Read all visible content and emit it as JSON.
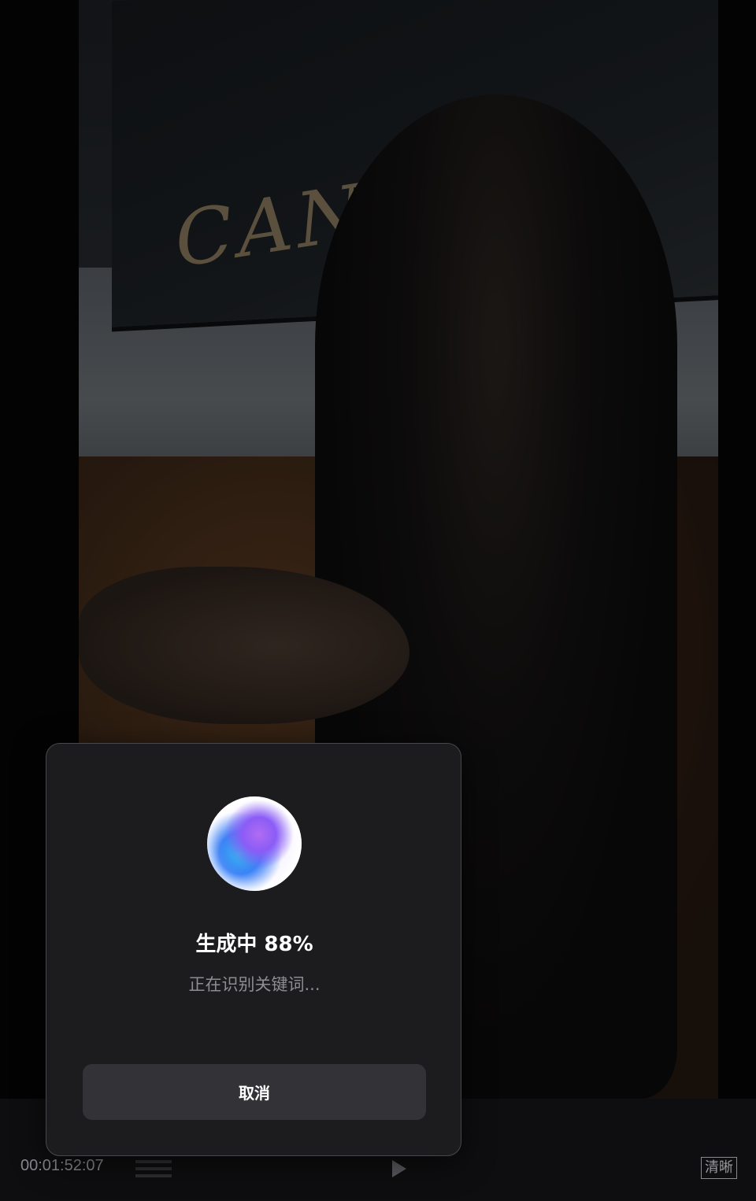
{
  "video": {
    "poster_text": "CAN"
  },
  "player": {
    "timecode": "00:01:52:07",
    "quality_label": "清晰"
  },
  "modal": {
    "title": "生成中 88%",
    "progress_percent": 88,
    "subtitle": "正在识别关键词...",
    "cancel_label": "取消"
  },
  "icons": {
    "orb": "ai-orb-icon",
    "grid": "timeline-grid-icon",
    "play": "play-icon"
  },
  "colors": {
    "modal_bg": "#1c1c1e",
    "button_bg": "#333337",
    "orb_purple": "#b06cf2",
    "orb_blue": "#38b6ef"
  }
}
